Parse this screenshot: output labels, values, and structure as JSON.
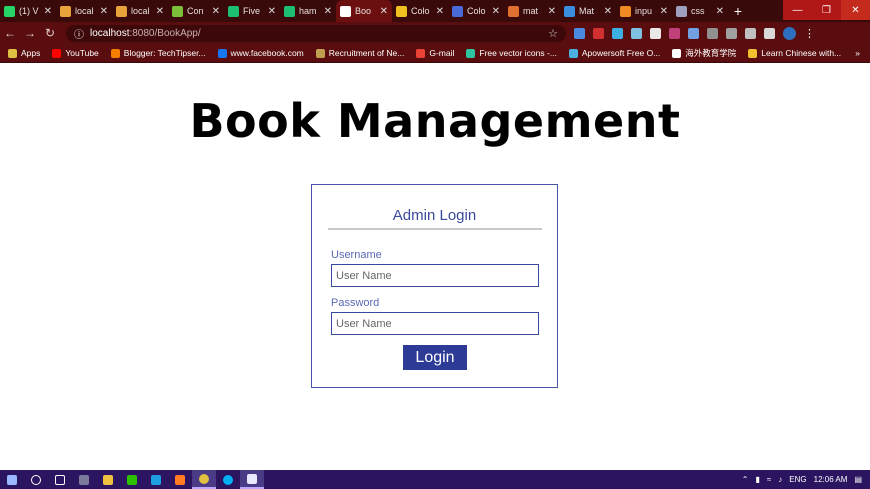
{
  "browser": {
    "tabs": [
      {
        "title": "(1) V",
        "favicon_color": "#25d366"
      },
      {
        "title": "local",
        "favicon_color": "#e8a33a"
      },
      {
        "title": "local",
        "favicon_color": "#e8a33a"
      },
      {
        "title": "Con",
        "favicon_color": "#7bbf3a"
      },
      {
        "title": "Five",
        "favicon_color": "#1dbf73"
      },
      {
        "title": "ham",
        "favicon_color": "#1dbf73"
      },
      {
        "title": "Boo",
        "favicon_color": "#ffffff",
        "active": true
      },
      {
        "title": "Colo",
        "favicon_color": "#f0c020"
      },
      {
        "title": "Colo",
        "favicon_color": "#4a6ad8"
      },
      {
        "title": "mat",
        "favicon_color": "#e07030"
      },
      {
        "title": "Mat",
        "favicon_color": "#3b8de0"
      },
      {
        "title": "inpu",
        "favicon_color": "#f08a24"
      },
      {
        "title": "css",
        "favicon_color": "#a0a0c0"
      }
    ],
    "new_tab": "+",
    "url_host": "localhost",
    "url_path": ":8080/BookApp/",
    "bookmarks": [
      {
        "label": "Apps",
        "color": "#e0c040"
      },
      {
        "label": "YouTube",
        "color": "#ff0000"
      },
      {
        "label": "Blogger: TechTipser...",
        "color": "#f57d00"
      },
      {
        "label": "www.facebook.com",
        "color": "#1877f2"
      },
      {
        "label": "Recruitment of Ne...",
        "color": "#c0a050"
      },
      {
        "label": "G-mail",
        "color": "#ea4335"
      },
      {
        "label": "Free vector icons -...",
        "color": "#2ec4a0"
      },
      {
        "label": "Apowersoft Free O...",
        "color": "#4ab0e0"
      },
      {
        "label": "海外教育学院",
        "color": "#ffffff"
      },
      {
        "label": "Learn Chinese with...",
        "color": "#f0c030"
      }
    ],
    "bookmarks_more": "»"
  },
  "page": {
    "heading": "Book Management",
    "login_card": {
      "title": "Admin Login",
      "username_label": "Username",
      "username_placeholder": "User Name",
      "password_label": "Password",
      "password_placeholder": "User Name",
      "button": "Login"
    }
  },
  "taskbar": {
    "language": "ENG",
    "time": "12:06 AM"
  }
}
